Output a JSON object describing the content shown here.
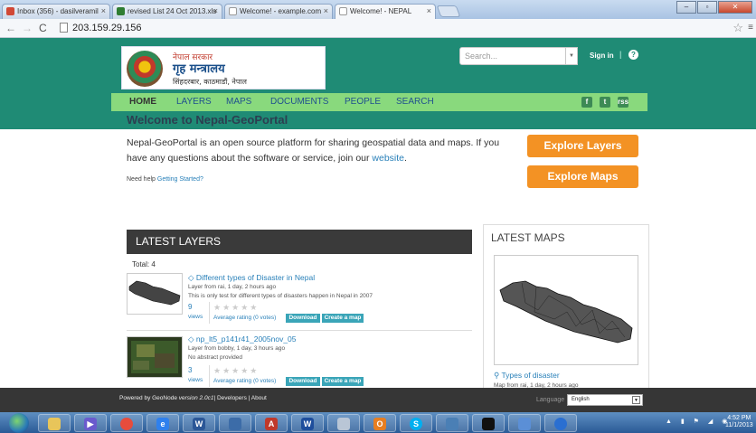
{
  "browser": {
    "tabs": [
      {
        "label": "Inbox (356) - dasilveramil",
        "icon": "gmail-icon",
        "color": "#d14836"
      },
      {
        "label": "revised List 24 Oct 2013.xls",
        "icon": "drive-icon",
        "color": "#2f7d32"
      },
      {
        "label": "Welcome! - example.com",
        "icon": "page-icon",
        "color": "#ffffff"
      },
      {
        "label": "Welcome! - NEPAL",
        "icon": "page-icon",
        "color": "#ffffff"
      }
    ],
    "url": "203.159.29.156"
  },
  "header": {
    "logo_line1": "नेपाल सरकार",
    "logo_line2": "गृह मन्त्रालय",
    "logo_line3": "सिंहदरबार, काठमाडौं, नेपाल",
    "search_placeholder": "Search...",
    "signin": "Sign in",
    "separator": "|",
    "help_icon": "?",
    "nav": [
      "HOME",
      "LAYERS",
      "MAPS",
      "DOCUMENTS",
      "PEOPLE",
      "SEARCH"
    ],
    "social": [
      "f",
      "t",
      "rss"
    ]
  },
  "main": {
    "welcome": "Welcome to Nepal-GeoPortal",
    "intro_text": "Nepal-GeoPortal is an open source platform for sharing geospatial data and maps. If you have any questions about the software or service, join our",
    "intro_link": "website",
    "intro_end": ".",
    "need_help": "Need help",
    "getting_started": "Getting Started?",
    "explore_layers": "Explore Layers",
    "explore_maps": "Explore Maps"
  },
  "latest_layers": {
    "heading": "LATEST LAYERS",
    "total": "Total: 4",
    "items": [
      {
        "title": "Different types of Disaster in Nepal",
        "meta": "Layer from rai, 1 day, 2 hours ago",
        "abstract": "This is only test for different types of disasters happen in Nepal in 2007",
        "views": "9",
        "views_label": "views",
        "rating": "Average rating (0 votes)",
        "download": "Download",
        "create_map": "Create a map"
      },
      {
        "title": "np_lt5_p141r41_2005nov_05",
        "meta": "Layer from bobby, 1 day, 3 hours ago",
        "abstract": "No abstract provided",
        "views": "3",
        "views_label": "views",
        "rating": "Average rating (0 votes)",
        "download": "Download",
        "create_map": "Create a map"
      }
    ]
  },
  "latest_maps": {
    "heading": "LATEST MAPS",
    "title": "Types of disaster",
    "meta": "Map from rai, 1 day, 2 hours ago"
  },
  "footer": {
    "powered": "Powered by GeoNode",
    "version": "version 2.0c1",
    "links": "| Developers | About",
    "language_label": "Language",
    "language_value": "English"
  },
  "taskbar": {
    "time": "4:52 PM",
    "date": "11/1/2013"
  }
}
